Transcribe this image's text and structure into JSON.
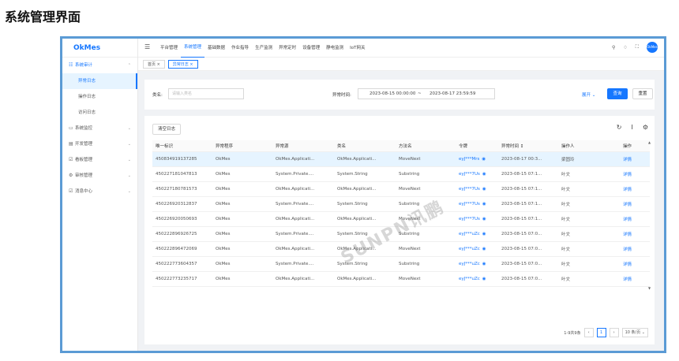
{
  "page_heading": "系统管理界面",
  "sidebar": {
    "logo": "OkMes",
    "menus": [
      {
        "icon": "☷",
        "label": "系统审计",
        "open": true,
        "chev": "⌃"
      },
      {
        "icon": "▭",
        "label": "系统监控",
        "chev": "⌄"
      },
      {
        "icon": "▤",
        "label": "开发管理",
        "chev": "⌄"
      },
      {
        "icon": "☑",
        "label": "看板管理",
        "chev": "⌄"
      },
      {
        "icon": "⚙",
        "label": "审核管理",
        "chev": "⌄"
      },
      {
        "icon": "☑",
        "label": "消息中心",
        "chev": "⌄"
      }
    ],
    "sub_items": [
      "异常日志",
      "操作日志",
      "访问日志"
    ]
  },
  "topbar": {
    "nav": [
      "平台管理",
      "系统管理",
      "基础数据",
      "作业指导",
      "生产监测",
      "异常定时",
      "设备管理",
      "静电监测",
      "IoT网关"
    ],
    "active_nav": "系统管理",
    "avatar": "OkMes"
  },
  "tabs": {
    "home": "首页",
    "current": "异常日志"
  },
  "search": {
    "label_name": "类名:",
    "name_placeholder": "请输入类名",
    "label_time": "异常时间:",
    "date_start": "2023-08-15 00:00:00",
    "date_sep": "~",
    "date_end": "2023-08-17 23:59:59",
    "expand": "展开",
    "search_btn": "查询",
    "reset_btn": "重置"
  },
  "table": {
    "clear_btn": "清空日志",
    "columns": [
      "唯一标识",
      "异常程序",
      "异常源",
      "类名",
      "方法名",
      "令牌",
      "异常时间 ↕",
      "操作人",
      "操作"
    ],
    "rows": [
      [
        "450834919137285",
        "OkMes",
        "OkMes.Applicati...",
        "OkMes.Applicati...",
        "MoveNext",
        "eyJ***Mrs",
        "2023-08-17 00:3...",
        "梁固玲",
        "详情"
      ],
      [
        "450227181047813",
        "OkMes",
        "System.Private....",
        "System.String",
        "Substring",
        "eyJ***7Us",
        "2023-08-15 07:1...",
        "叶文",
        "详情"
      ],
      [
        "450227180781573",
        "OkMes",
        "OkMes.Applicati...",
        "OkMes.Applicati...",
        "MoveNext",
        "eyJ***7Us",
        "2023-08-15 07:1...",
        "叶文",
        "详情"
      ],
      [
        "450226920312837",
        "OkMes",
        "System.Private....",
        "System.String",
        "Substring",
        "eyJ***7Us",
        "2023-08-15 07:1...",
        "叶文",
        "详情"
      ],
      [
        "450226920050693",
        "OkMes",
        "OkMes.Applicati...",
        "OkMes.Applicati...",
        "MoveNext",
        "eyJ***7Us",
        "2023-08-15 07:1...",
        "叶文",
        "详情"
      ],
      [
        "450222896926725",
        "OkMes",
        "System.Private....",
        "System.String",
        "Substring",
        "eyJ***uZc",
        "2023-08-15 07:0...",
        "叶文",
        "详情"
      ],
      [
        "450222896472069",
        "OkMes",
        "OkMes.Applicati...",
        "OkMes.Applicati...",
        "MoveNext",
        "eyJ***uZc",
        "2023-08-15 07:0...",
        "叶文",
        "详情"
      ],
      [
        "450222773604357",
        "OkMes",
        "System.Private....",
        "System.String",
        "Substring",
        "eyJ***uZc",
        "2023-08-15 07:0...",
        "叶文",
        "详情"
      ],
      [
        "450222773235717",
        "OkMes",
        "OkMes.Applicati...",
        "OkMes.Applicati...",
        "MoveNext",
        "eyJ***uZc",
        "2023-08-15 07:0...",
        "叶文",
        "详情"
      ]
    ]
  },
  "pager": {
    "total": "1-9共9条",
    "page": "1",
    "page_size": "10 条/页"
  },
  "watermark": "SUNPN讯鹏",
  "colors": {
    "accent": "#1677ff",
    "frame": "#5b9bd5"
  }
}
